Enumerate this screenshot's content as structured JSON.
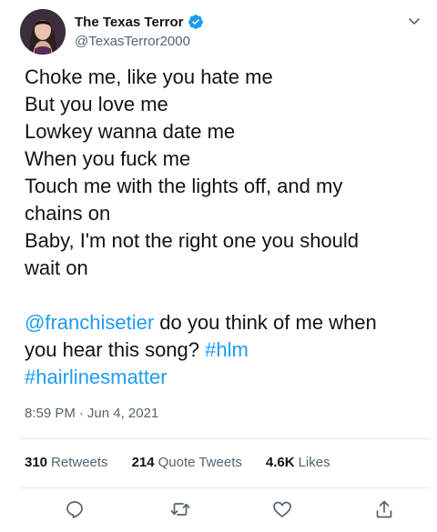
{
  "author": {
    "display_name": "The Texas Terror",
    "handle": "@TexasTerror2000",
    "verified_icon": "verified-badge-icon",
    "accent_color": "#1d9bf0"
  },
  "tweet": {
    "lines": [
      "Choke me, like you hate me",
      "But you love me",
      "Lowkey wanna date me",
      "When you fuck me",
      "Touch me with the lights off, and my",
      "chains on",
      "Baby, I'm not the right one you should",
      "wait on"
    ],
    "mention": "@franchisetier",
    "after_mention": " do you think of me when",
    "line_two_text": "you hear this song? ",
    "hashtag_one": "#hlm",
    "hashtag_two": "#hairlinesmatter"
  },
  "meta": {
    "time": "8:59 PM",
    "separator": "·",
    "date": "Jun 4, 2021"
  },
  "stats": {
    "retweets_count": "310",
    "retweets_label": "Retweets",
    "quotes_count": "214",
    "quotes_label": "Quote Tweets",
    "likes_count": "4.6K",
    "likes_label": "Likes"
  },
  "actions": {
    "reply": "reply-icon",
    "retweet": "retweet-icon",
    "like": "heart-icon",
    "share": "share-icon"
  }
}
